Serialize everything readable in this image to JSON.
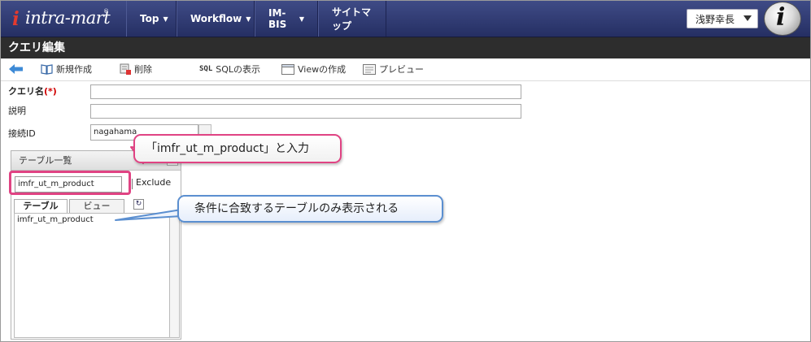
{
  "header": {
    "logo_text": "intra-mart",
    "logo_reg": "®",
    "nav": [
      {
        "label": "Top"
      },
      {
        "label": "Workflow"
      },
      {
        "label": "IM-BIS"
      },
      {
        "label": "サイトマップ"
      }
    ],
    "user": "浅野幸長",
    "badge": "i"
  },
  "page_title": "クエリ編集",
  "toolbar": {
    "new": "新規作成",
    "delete": "削除",
    "sql_icon": "SQL",
    "sql_view": "SQLの表示",
    "create_view": "Viewの作成",
    "preview": "プレビュー"
  },
  "form": {
    "query_name_label": "クエリ名",
    "required_mark": "(*)",
    "description_label": "説明",
    "connection_label": "接続ID",
    "connection_value": "nagahama"
  },
  "table_panel": {
    "title": "テーブル一覧",
    "filter_value": "imfr_ut_m_product",
    "exclude_label": "Exclude",
    "tabs": [
      "テーブル",
      "ビュー"
    ],
    "items": [
      "imfr_ut_m_product"
    ]
  },
  "annotations": {
    "callout_input": "「imfr_ut_m_product」と入力",
    "callout_result": "条件に合致するテーブルのみ表示される"
  },
  "colors": {
    "header": "#2f3a73",
    "title_bar": "#2d2d2d",
    "callout_pink": "#e04383",
    "callout_blue": "#5b8fd0"
  }
}
